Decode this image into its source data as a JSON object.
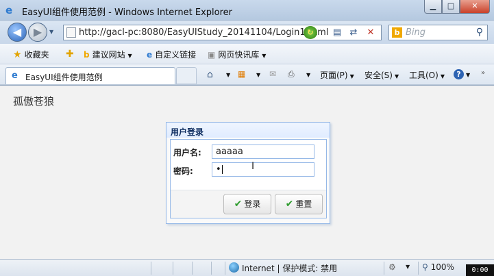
{
  "window": {
    "title": "EasyUI组件使用范例 - Windows Internet Explorer",
    "controls": {
      "minimize": "▁",
      "maximize": "□",
      "close": "✕"
    }
  },
  "nav": {
    "back_icon": "back-arrow-icon",
    "forward_icon": "forward-arrow-icon",
    "url": "http://gacl-pc:8080/EasyUIStudy_20141104/Login1.html",
    "search_placeholder": "Bing",
    "search_engine": "b"
  },
  "favorites": {
    "favorites_label": "收藏夹",
    "suggested_sites": "建议网站",
    "custom_links": "自定义链接",
    "web_slice_gallery": "网页快讯库"
  },
  "tabs": [
    {
      "label": "EasyUI组件使用范例"
    }
  ],
  "command_bar": {
    "page_menu": "页面(P)",
    "safety_menu": "安全(S)",
    "tools_menu": "工具(O)",
    "help": "?"
  },
  "page": {
    "heading": "孤傲苍狼"
  },
  "login": {
    "title": "用户登录",
    "username_label": "用户名:",
    "username_value": "aaaaa",
    "password_label": "密码:",
    "password_value": "•",
    "login_button": "登录",
    "reset_button": "重置"
  },
  "status": {
    "zone": "Internet | 保护模式: 禁用",
    "zoom": "100%"
  },
  "overlay": {
    "timer": "0:00"
  },
  "colors": {
    "panel_border": "#95b8e7",
    "panel_title_bg": "#e0ecff",
    "check_green": "#2f9c2f"
  }
}
